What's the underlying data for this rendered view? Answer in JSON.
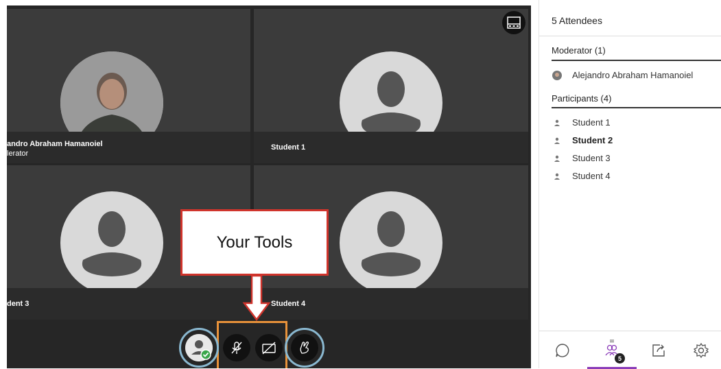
{
  "tiles": [
    {
      "name": "andro Abraham Hamanoiel",
      "role": "lerator"
    },
    {
      "name": "Student 1"
    },
    {
      "name": "dent 3"
    },
    {
      "name": "Student 4"
    }
  ],
  "callout": {
    "label": "Your Tools"
  },
  "panel": {
    "title": "5 Attendees",
    "moderator_header": "Moderator (1)",
    "moderator": "Alejandro Abraham Hamanoiel",
    "participants_header": "Participants (4)",
    "participants": [
      "Student 1",
      "Student 2",
      "Student 3",
      "Student 4"
    ],
    "attendee_badge": "5"
  },
  "colors": {
    "accent": "#8a3bb8",
    "callout_border": "#d0342c",
    "tools_border": "#e8923a",
    "ring": "#8ab8d0",
    "presence": "#3aa64a"
  }
}
